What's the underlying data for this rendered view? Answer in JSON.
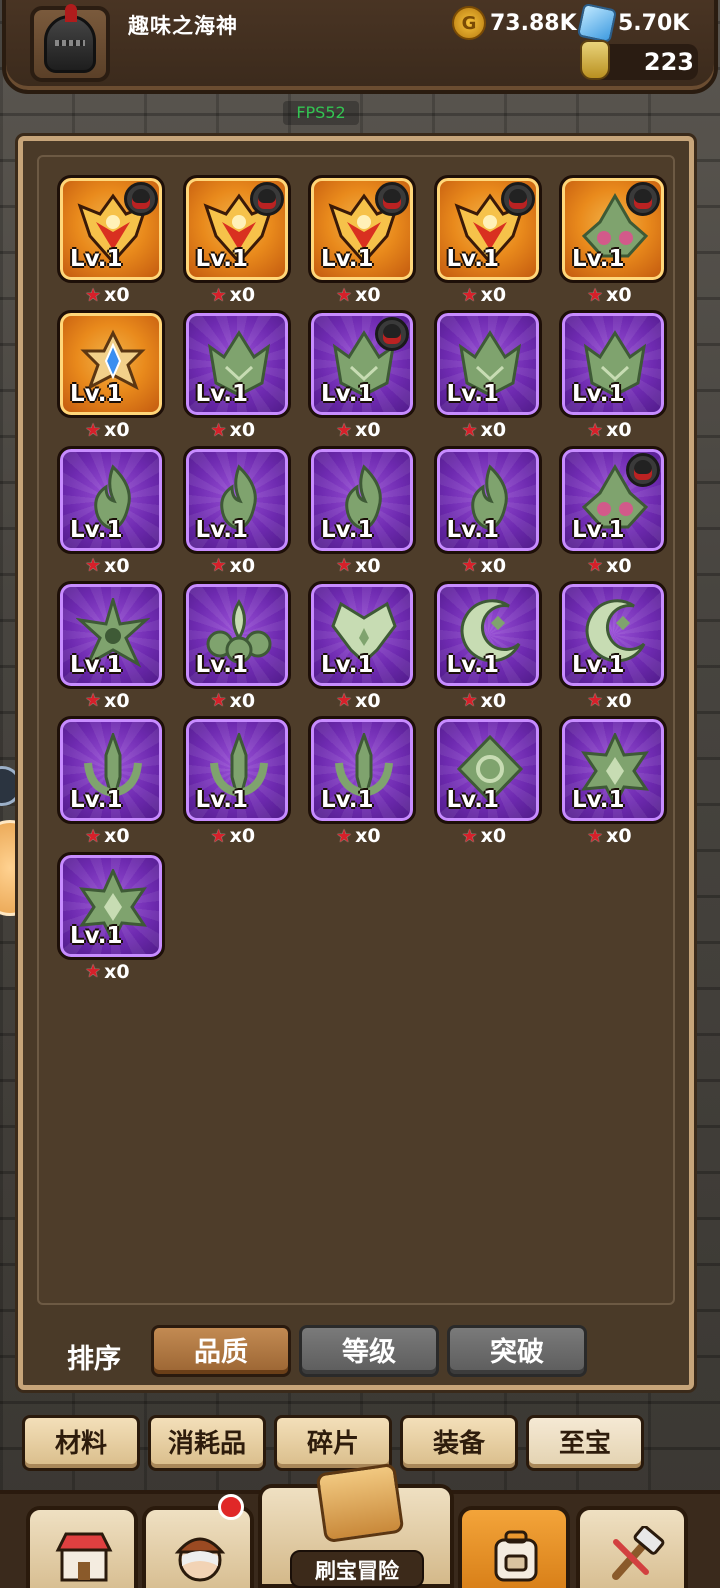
{
  "player": {
    "name": "趣味之海神"
  },
  "resources": {
    "gold": "73.88K",
    "gems": "5.70K",
    "potion": "223"
  },
  "fps": "FPS52",
  "treasures": [
    {
      "level": "Lv.1",
      "count": "x0",
      "rarity": "orange",
      "icon": "flame-crest-icon",
      "owner": true
    },
    {
      "level": "Lv.1",
      "count": "x0",
      "rarity": "orange",
      "icon": "flame-crest-icon",
      "owner": true
    },
    {
      "level": "Lv.1",
      "count": "x0",
      "rarity": "orange",
      "icon": "flame-crest-icon",
      "owner": true
    },
    {
      "level": "Lv.1",
      "count": "x0",
      "rarity": "orange",
      "icon": "flame-crest-icon",
      "owner": true
    },
    {
      "level": "Lv.1",
      "count": "x0",
      "rarity": "orange",
      "icon": "jade-helm-icon",
      "owner": true
    },
    {
      "level": "Lv.1",
      "count": "x0",
      "rarity": "orange",
      "icon": "blue-star-gem-icon",
      "owner": false
    },
    {
      "level": "Lv.1",
      "count": "x0",
      "rarity": "purple",
      "icon": "jade-crown-icon",
      "owner": false
    },
    {
      "level": "Lv.1",
      "count": "x0",
      "rarity": "purple",
      "icon": "jade-crown-icon",
      "owner": true
    },
    {
      "level": "Lv.1",
      "count": "x0",
      "rarity": "purple",
      "icon": "jade-crown-icon",
      "owner": false
    },
    {
      "level": "Lv.1",
      "count": "x0",
      "rarity": "purple",
      "icon": "jade-crown-icon",
      "owner": false
    },
    {
      "level": "Lv.1",
      "count": "x0",
      "rarity": "purple",
      "icon": "jade-flame-icon",
      "owner": false
    },
    {
      "level": "Lv.1",
      "count": "x0",
      "rarity": "purple",
      "icon": "jade-flame-icon",
      "owner": false
    },
    {
      "level": "Lv.1",
      "count": "x0",
      "rarity": "purple",
      "icon": "jade-flame-icon",
      "owner": false
    },
    {
      "level": "Lv.1",
      "count": "x0",
      "rarity": "purple",
      "icon": "jade-flame-icon",
      "owner": false
    },
    {
      "level": "Lv.1",
      "count": "x0",
      "rarity": "purple",
      "icon": "jade-helm-icon",
      "owner": true
    },
    {
      "level": "Lv.1",
      "count": "x0",
      "rarity": "purple",
      "icon": "jade-spiked-star-icon",
      "owner": false
    },
    {
      "level": "Lv.1",
      "count": "x0",
      "rarity": "purple",
      "icon": "jade-lotus-icon",
      "owner": false
    },
    {
      "level": "Lv.1",
      "count": "x0",
      "rarity": "purple",
      "icon": "jade-wings-icon",
      "owner": false
    },
    {
      "level": "Lv.1",
      "count": "x0",
      "rarity": "purple",
      "icon": "jade-crescent-icon",
      "owner": false
    },
    {
      "level": "Lv.1",
      "count": "x0",
      "rarity": "purple",
      "icon": "jade-crescent-icon",
      "owner": false
    },
    {
      "level": "Lv.1",
      "count": "x0",
      "rarity": "purple",
      "icon": "jade-trident-icon",
      "owner": false
    },
    {
      "level": "Lv.1",
      "count": "x0",
      "rarity": "purple",
      "icon": "jade-trident-icon",
      "owner": false
    },
    {
      "level": "Lv.1",
      "count": "x0",
      "rarity": "purple",
      "icon": "jade-trident-icon",
      "owner": false
    },
    {
      "level": "Lv.1",
      "count": "x0",
      "rarity": "purple",
      "icon": "jade-diamond-icon",
      "owner": false
    },
    {
      "level": "Lv.1",
      "count": "x0",
      "rarity": "purple",
      "icon": "jade-star-icon",
      "owner": false
    },
    {
      "level": "Lv.1",
      "count": "x0",
      "rarity": "purple",
      "icon": "jade-star-icon",
      "owner": false
    }
  ],
  "sort": {
    "label": "排序",
    "options": [
      "品质",
      "等级",
      "突破"
    ],
    "active": 0
  },
  "tabs": {
    "items": [
      "材料",
      "消耗品",
      "碎片",
      "装备",
      "至宝"
    ],
    "active": 4
  },
  "nav": {
    "center_label": "刷宝冒险",
    "items": [
      "shop-icon",
      "hero-icon",
      "treasure-map-icon",
      "backpack-icon",
      "forge-icon"
    ],
    "active": 3
  },
  "colors": {
    "orange_rarity": "#e98a1c",
    "purple_rarity": "#6e2ab0",
    "fps_text": "#33c452",
    "count_star": "#d6202a"
  }
}
